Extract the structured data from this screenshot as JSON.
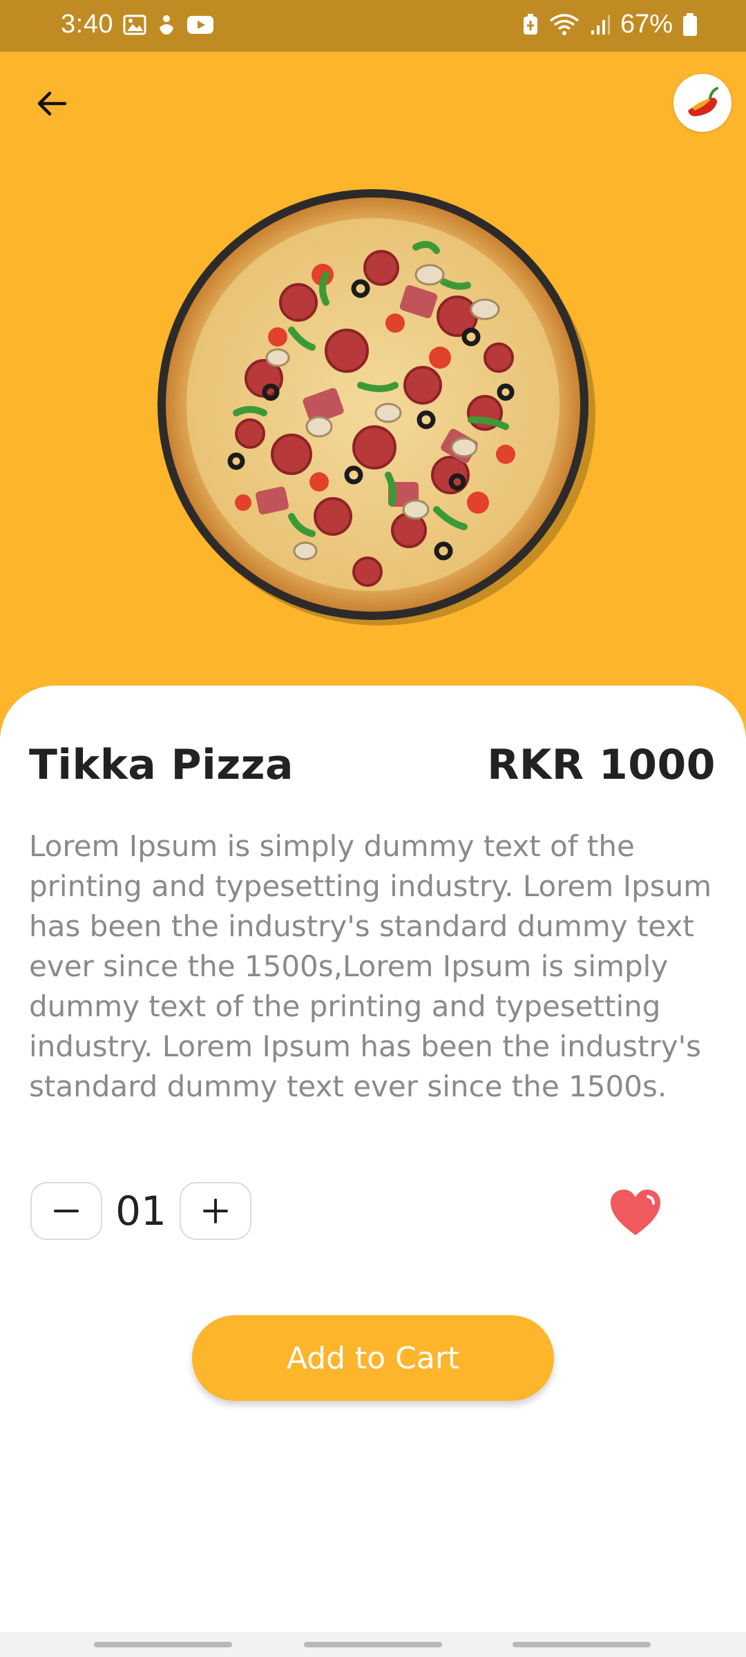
{
  "status_bar": {
    "time": "3:40",
    "battery": "67%"
  },
  "header": {
    "back_icon": "arrow-left-icon",
    "logo_icon": "chili-logo-icon"
  },
  "product": {
    "name": "Tikka Pizza",
    "price": "RKR 1000",
    "description": "Lorem Ipsum is simply dummy text of the printing and typesetting industry. Lorem Ipsum has been the industry's standard dummy text ever since the 1500s,Lorem Ipsum is simply dummy text of the printing and typesetting industry. Lorem Ipsum has been the industry's standard dummy text ever since the 1500s."
  },
  "quantity": {
    "value": "01",
    "decrement_icon": "minus-icon",
    "increment_icon": "plus-icon"
  },
  "favorite": {
    "icon": "heart-icon",
    "active": true
  },
  "cart": {
    "button_label": "Add to Cart"
  },
  "colors": {
    "accent": "#fdb52c",
    "status_bar": "#c18b23",
    "heart": "#f05a5f",
    "text_dark": "#222222",
    "text_muted": "#8a8a8a"
  }
}
